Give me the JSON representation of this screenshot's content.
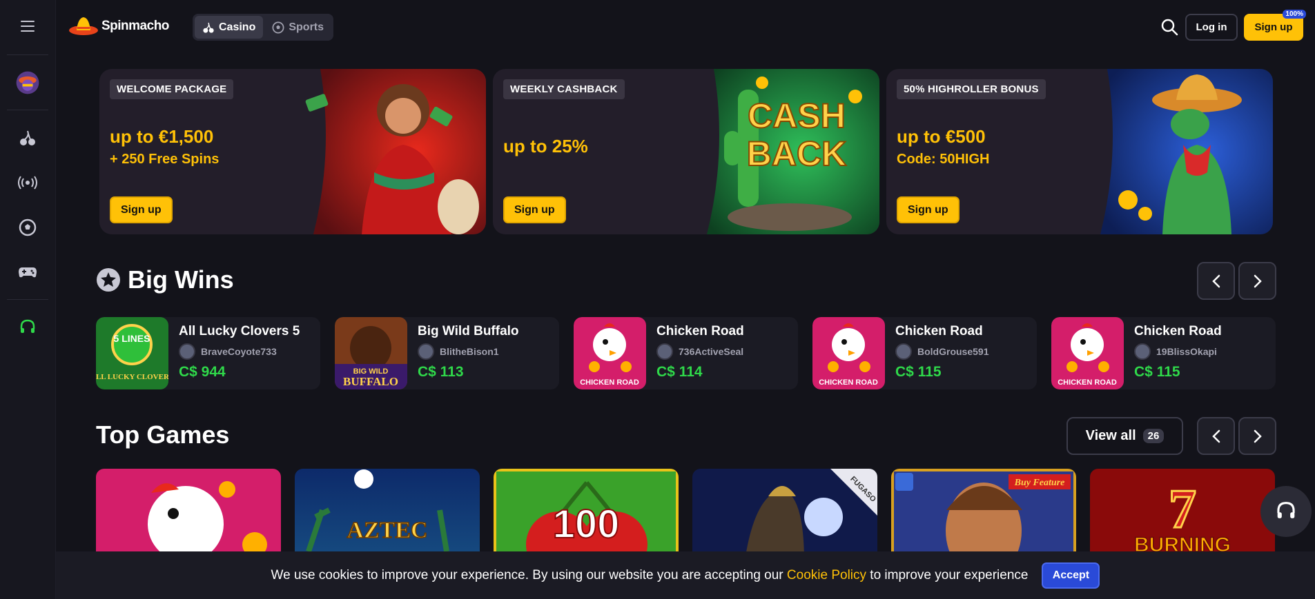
{
  "header": {
    "brand": "Spinmacho",
    "tabs": [
      {
        "label": "Casino",
        "active": true
      },
      {
        "label": "Sports",
        "active": false
      }
    ],
    "login_label": "Log in",
    "signup_label": "Sign up",
    "signup_badge": "100%"
  },
  "sidebar": {
    "items": [
      "menu-icon",
      "avatar-icon",
      "cherry-icon",
      "live-icon",
      "soccer-ball-icon",
      "gamepad-icon",
      "headset-icon"
    ]
  },
  "banners": [
    {
      "tag": "WELCOME PACKAGE",
      "title": "up to €1,500",
      "subtitle": "+ 250 Free Spins",
      "button": "Sign up"
    },
    {
      "tag": "WEEKLY CASHBACK",
      "title": "up to 25%",
      "subtitle": "",
      "button": "Sign up",
      "art_text_1": "CASH",
      "art_text_2": "BACK"
    },
    {
      "tag": "50% HIGHROLLER BONUS",
      "title": "up to €500",
      "subtitle": "Code: 50HIGH",
      "button": "Sign up"
    }
  ],
  "big_wins": {
    "title": "Big Wins",
    "items": [
      {
        "game": "All Lucky Clovers 5",
        "user": "BraveCoyote733",
        "amount": "C$ 944",
        "thumb_text": "5 LINES",
        "thumb_text_2": "ALL LUCKY CLOVERS"
      },
      {
        "game": "Big Wild Buffalo",
        "user": "BlitheBison1",
        "amount": "C$ 113",
        "thumb_text": "BIG WILD",
        "thumb_text_2": "BUFFALO"
      },
      {
        "game": "Chicken Road",
        "user": "736ActiveSeal",
        "amount": "C$ 114",
        "thumb_text": "CHICKEN ROAD"
      },
      {
        "game": "Chicken Road",
        "user": "BoldGrouse591",
        "amount": "C$ 115",
        "thumb_text": "CHICKEN ROAD"
      },
      {
        "game": "Chicken Road",
        "user": "19BlissOkapi",
        "amount": "C$ 115",
        "thumb_text": "CHICKEN ROAD"
      }
    ]
  },
  "top_games": {
    "title": "Top Games",
    "view_all_label": "View all",
    "count": "26",
    "tiles": [
      {
        "name": "Chicken Road",
        "label": ""
      },
      {
        "name": "Aztec",
        "label": "AZTEC"
      },
      {
        "name": "100 Cherries",
        "label": "100"
      },
      {
        "name": "Fugaso game",
        "label": "FUGASO"
      },
      {
        "name": "Buy Feature game",
        "label": "Buy Feature"
      },
      {
        "name": "Burning 7",
        "label": "BURNING"
      }
    ]
  },
  "cookie": {
    "text_before": "We use cookies to improve your experience. By using our website you are accepting our ",
    "link": "Cookie Policy",
    "text_after": " to improve your experience",
    "accept": "Accept"
  },
  "colors": {
    "accent": "#ffc107",
    "win_green": "#2fd94a",
    "bg": "#13131a",
    "accept_blue": "#2a4ad8"
  }
}
